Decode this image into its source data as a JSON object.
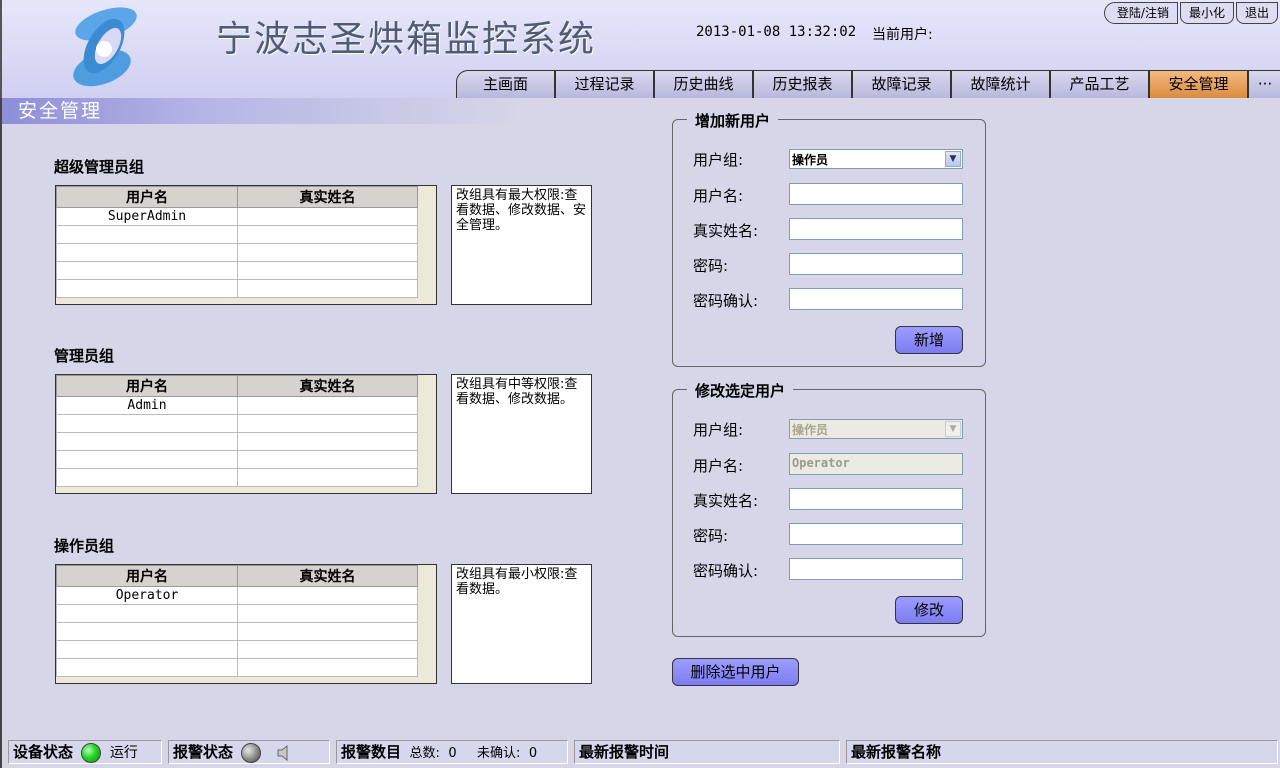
{
  "header": {
    "title": "宁波志圣烘箱监控系统",
    "datetime": "2013-01-08 13:32:02",
    "current_user_label": "当前用户:"
  },
  "window_buttons": [
    "登陆/注销",
    "最小化",
    "退出"
  ],
  "nav_tabs": [
    "主画面",
    "过程记录",
    "历史曲线",
    "历史报表",
    "故障记录",
    "故障统计",
    "产品工艺",
    "安全管理",
    "···"
  ],
  "active_tab": "安全管理",
  "section_title": "安全管理",
  "groups": [
    {
      "title": "超级管理员组",
      "columns": [
        "用户名",
        "真实姓名"
      ],
      "rows": [
        [
          "SuperAdmin",
          ""
        ],
        [
          "",
          ""
        ],
        [
          "",
          ""
        ],
        [
          "",
          ""
        ],
        [
          "",
          ""
        ]
      ],
      "description": "改组具有最大权限:查看数据、修改数据、安全管理。"
    },
    {
      "title": "管理员组",
      "columns": [
        "用户名",
        "真实姓名"
      ],
      "rows": [
        [
          "Admin",
          ""
        ],
        [
          "",
          ""
        ],
        [
          "",
          ""
        ],
        [
          "",
          ""
        ],
        [
          "",
          ""
        ]
      ],
      "description": "改组具有中等权限:查看数据、修改数据。"
    },
    {
      "title": "操作员组",
      "columns": [
        "用户名",
        "真实姓名"
      ],
      "rows": [
        [
          "Operator",
          ""
        ],
        [
          "",
          ""
        ],
        [
          "",
          ""
        ],
        [
          "",
          ""
        ],
        [
          "",
          ""
        ]
      ],
      "description": "改组具有最小权限:查看数据。"
    }
  ],
  "add_user": {
    "legend": "增加新用户",
    "group_label": "用户组:",
    "group_value": "操作员",
    "username_label": "用户名:",
    "realname_label": "真实姓名:",
    "password_label": "密码:",
    "confirm_label": "密码确认:",
    "submit_label": "新增"
  },
  "edit_user": {
    "legend": "修改选定用户",
    "group_label": "用户组:",
    "group_value": "操作员",
    "username_label": "用户名:",
    "username_value": "Operator",
    "realname_label": "真实姓名:",
    "password_label": "密码:",
    "confirm_label": "密码确认:",
    "submit_label": "修改"
  },
  "delete_label": "删除选中用户",
  "status_bar": {
    "device_status_label": "设备状态",
    "device_status_value": "运行",
    "alarm_status_label": "报警状态",
    "alarm_count_label": "报警数目",
    "total_label": "总数:",
    "total_value": "0",
    "unconfirmed_label": "未确认:",
    "unconfirmed_value": "0",
    "latest_alarm_time_label": "最新报警时间",
    "latest_alarm_name_label": "最新报警名称"
  },
  "colors": {
    "accent_tab": "#e8a060",
    "button": "#8c8cf8",
    "running_led": "#22cc22"
  }
}
